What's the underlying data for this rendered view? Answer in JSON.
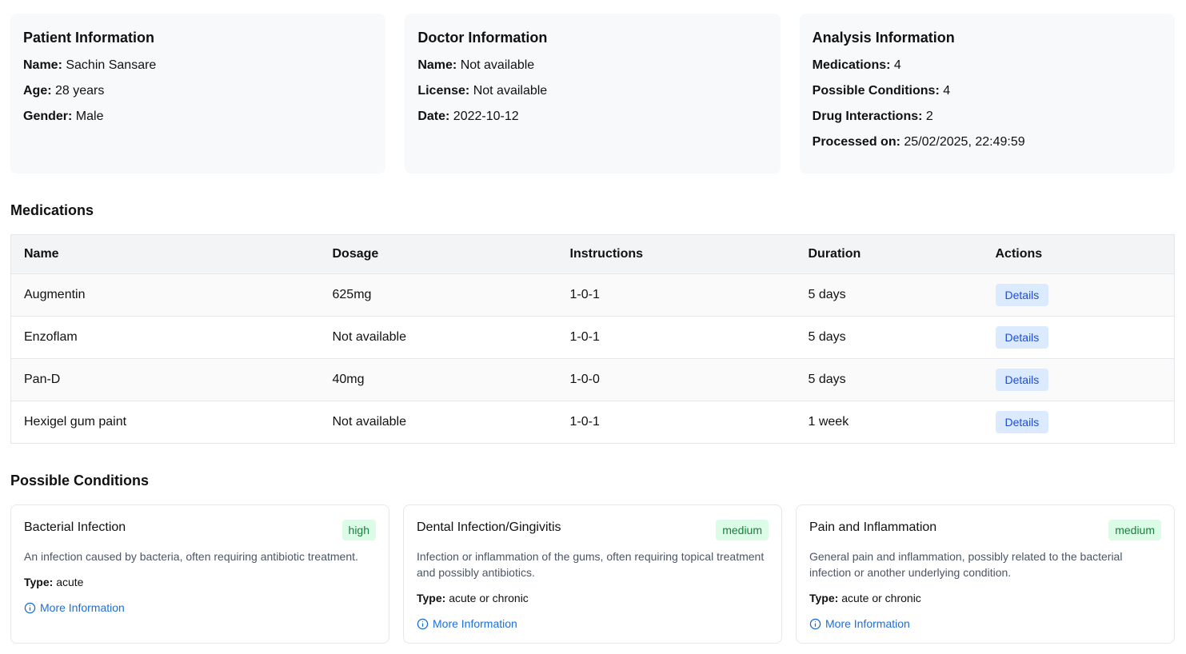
{
  "patient": {
    "title": "Patient Information",
    "name_label": "Name:",
    "name": "Sachin Sansare",
    "age_label": "Age:",
    "age": "28 years",
    "gender_label": "Gender:",
    "gender": "Male"
  },
  "doctor": {
    "title": "Doctor Information",
    "name_label": "Name:",
    "name": "Not available",
    "license_label": "License:",
    "license": "Not available",
    "date_label": "Date:",
    "date": "2022-10-12"
  },
  "analysis": {
    "title": "Analysis Information",
    "medications_label": "Medications:",
    "medications": "4",
    "conditions_label": "Possible Conditions:",
    "conditions": "4",
    "interactions_label": "Drug Interactions:",
    "interactions": "2",
    "processed_label": "Processed on:",
    "processed": "25/02/2025, 22:49:59"
  },
  "medications": {
    "title": "Medications",
    "headers": [
      "Name",
      "Dosage",
      "Instructions",
      "Duration",
      "Actions"
    ],
    "details_label": "Details",
    "rows": [
      {
        "name": "Augmentin",
        "dosage": "625mg",
        "instructions": "1-0-1",
        "duration": "5 days"
      },
      {
        "name": "Enzoflam",
        "dosage": "Not available",
        "instructions": "1-0-1",
        "duration": "5 days"
      },
      {
        "name": "Pan-D",
        "dosage": "40mg",
        "instructions": "1-0-0",
        "duration": "5 days"
      },
      {
        "name": "Hexigel gum paint",
        "dosage": "Not available",
        "instructions": "1-0-1",
        "duration": "1 week"
      }
    ]
  },
  "conditions": {
    "title": "Possible Conditions",
    "type_label": "Type:",
    "more_info_label": "More Information",
    "items": [
      {
        "name": "Bacterial Infection",
        "likelihood": "high",
        "description": "An infection caused by bacteria, often requiring antibiotic treatment.",
        "type": "acute"
      },
      {
        "name": "Dental Infection/Gingivitis",
        "likelihood": "medium",
        "description": "Infection or inflammation of the gums, often requiring topical treatment and possibly antibiotics.",
        "type": "acute or chronic"
      },
      {
        "name": "Pain and Inflammation",
        "likelihood": "medium",
        "description": "General pain and inflammation, possibly related to the bacterial infection or another underlying condition.",
        "type": "acute or chronic"
      }
    ]
  },
  "colors": {
    "badge_bg": "#dcfce7",
    "badge_text": "#15803d",
    "link": "#1d6fd8",
    "details_bg": "#dbeafe",
    "details_text": "#1d4ed8"
  },
  "icons": {
    "more_info": "info-circle-icon"
  }
}
